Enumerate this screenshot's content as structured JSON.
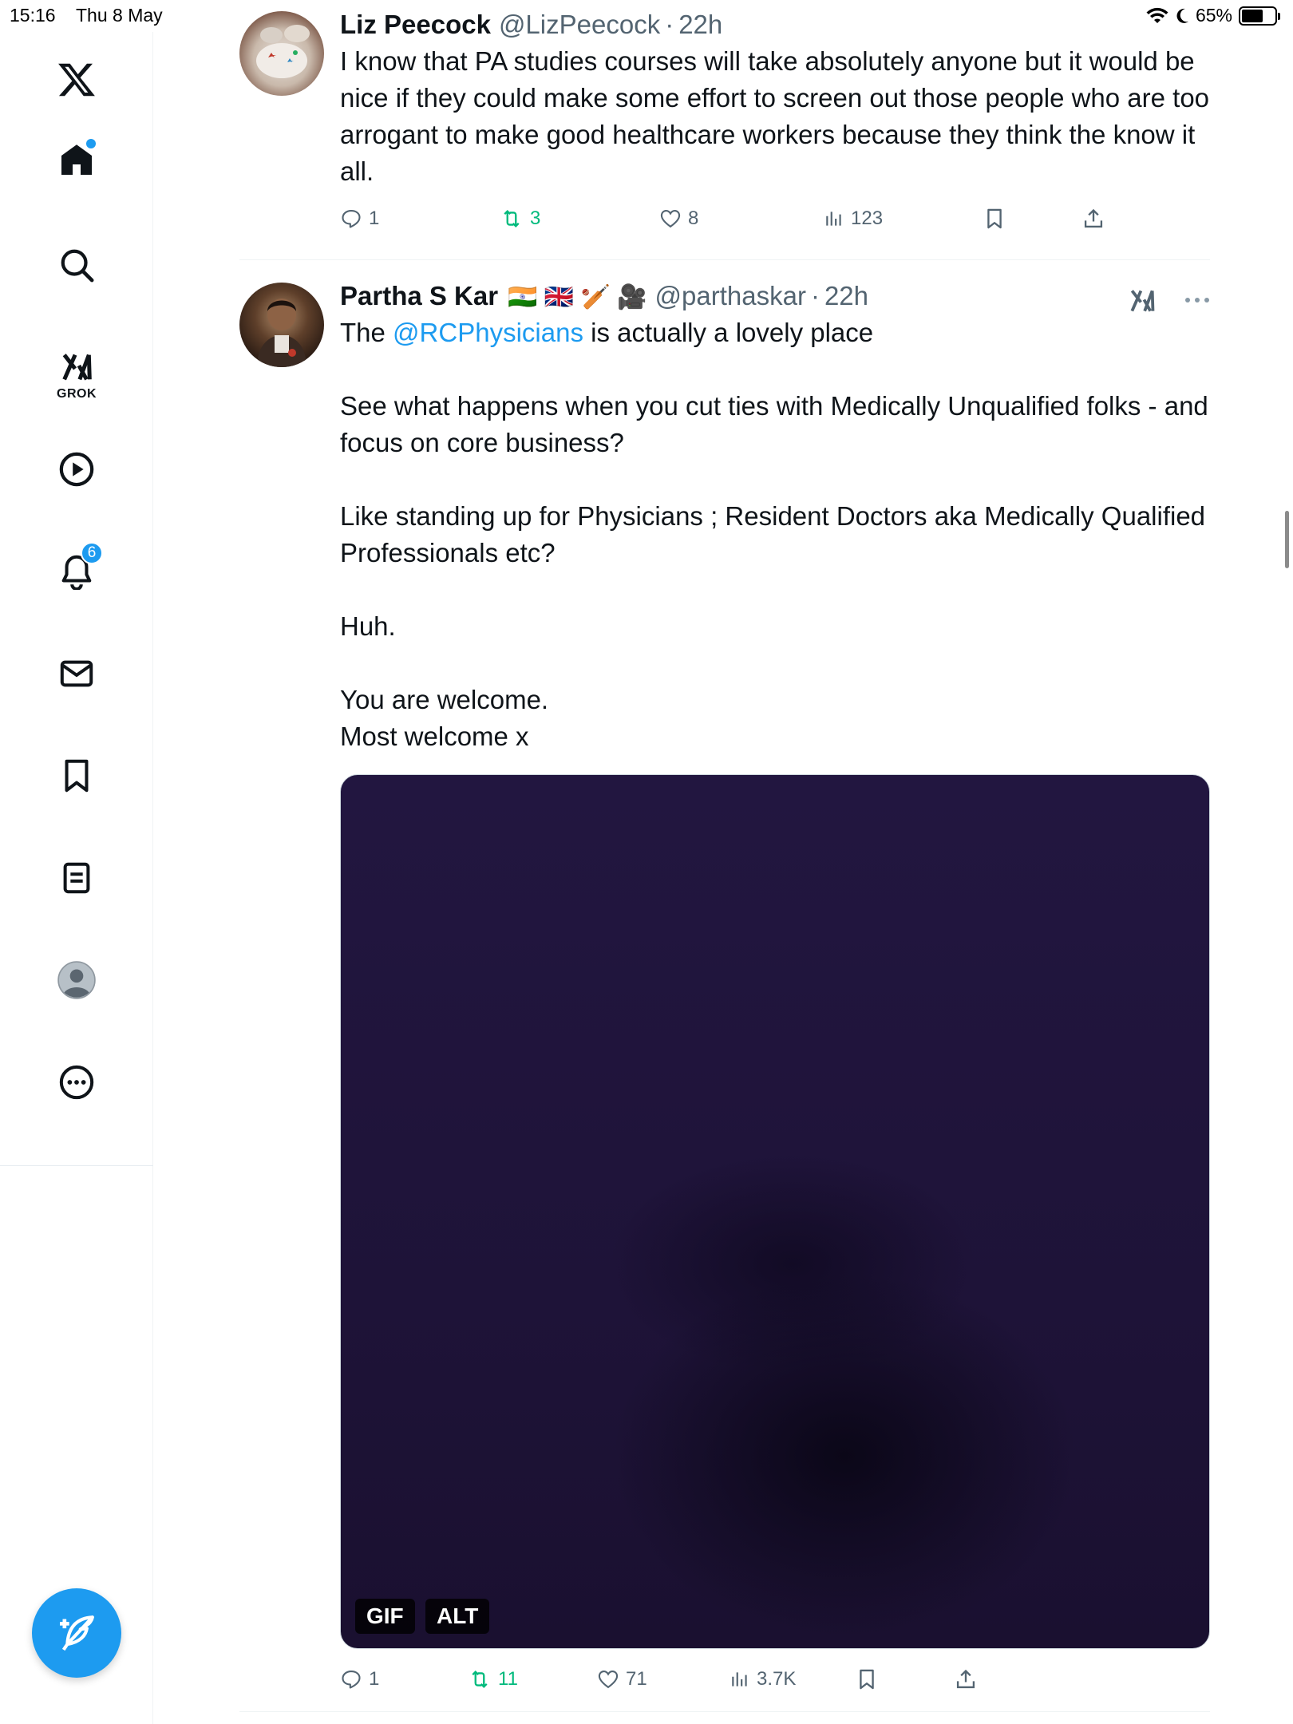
{
  "status_bar": {
    "time": "15:16",
    "date": "Thu 8 May",
    "battery": "65%",
    "battery_level": 0.65
  },
  "sidebar": {
    "logo": "x-logo-icon",
    "items": [
      {
        "name": "home",
        "icon": "home-icon",
        "has_dot": true
      },
      {
        "name": "explore",
        "icon": "search-icon"
      },
      {
        "name": "grok",
        "icon": "grok-icon",
        "label": "GROK"
      },
      {
        "name": "video",
        "icon": "play-icon"
      },
      {
        "name": "notifications",
        "icon": "bell-icon",
        "badge": "6"
      },
      {
        "name": "messages",
        "icon": "mail-icon"
      },
      {
        "name": "bookmarks",
        "icon": "bookmark-icon"
      },
      {
        "name": "lists",
        "icon": "list-icon"
      },
      {
        "name": "profile",
        "icon": "avatar-icon"
      },
      {
        "name": "more",
        "icon": "more-circle-icon"
      }
    ],
    "compose": "compose-icon"
  },
  "tweets": [
    {
      "author": "Liz Peecock",
      "handle": "@LizPeecock",
      "dot": "·",
      "time": "22h",
      "text": "I know that PA studies courses will take absolutely anyone but it would be nice if they could make some effort to screen out those people who are too arrogant to make good healthcare workers because they think the know it all.",
      "replies": "1",
      "retweets": "3",
      "likes": "8",
      "views": "123"
    },
    {
      "author": "Partha S Kar",
      "flags": "🇮🇳 🇬🇧 🏏 🎥",
      "handle": "@parthaskar",
      "dot": "·",
      "time": "22h",
      "text_pre": "The ",
      "mention": "@RCPhysicians",
      "text_post": " is actually a lovely place\n\nSee what happens when you cut ties with Medically Unqualified folks - and focus on core business?\n\nLike standing up for Physicians ; Resident Doctors aka Medically Qualified Professionals etc?\n\nHuh.\n\nYou are welcome.\nMost welcome x",
      "media_badges": {
        "gif": "GIF",
        "alt": "ALT"
      },
      "replies": "1",
      "retweets": "11",
      "likes": "71",
      "views": "3.7K"
    }
  ],
  "colors": {
    "accent": "#1d9bf0",
    "retweet": "#00ba7c",
    "muted": "#536471"
  }
}
